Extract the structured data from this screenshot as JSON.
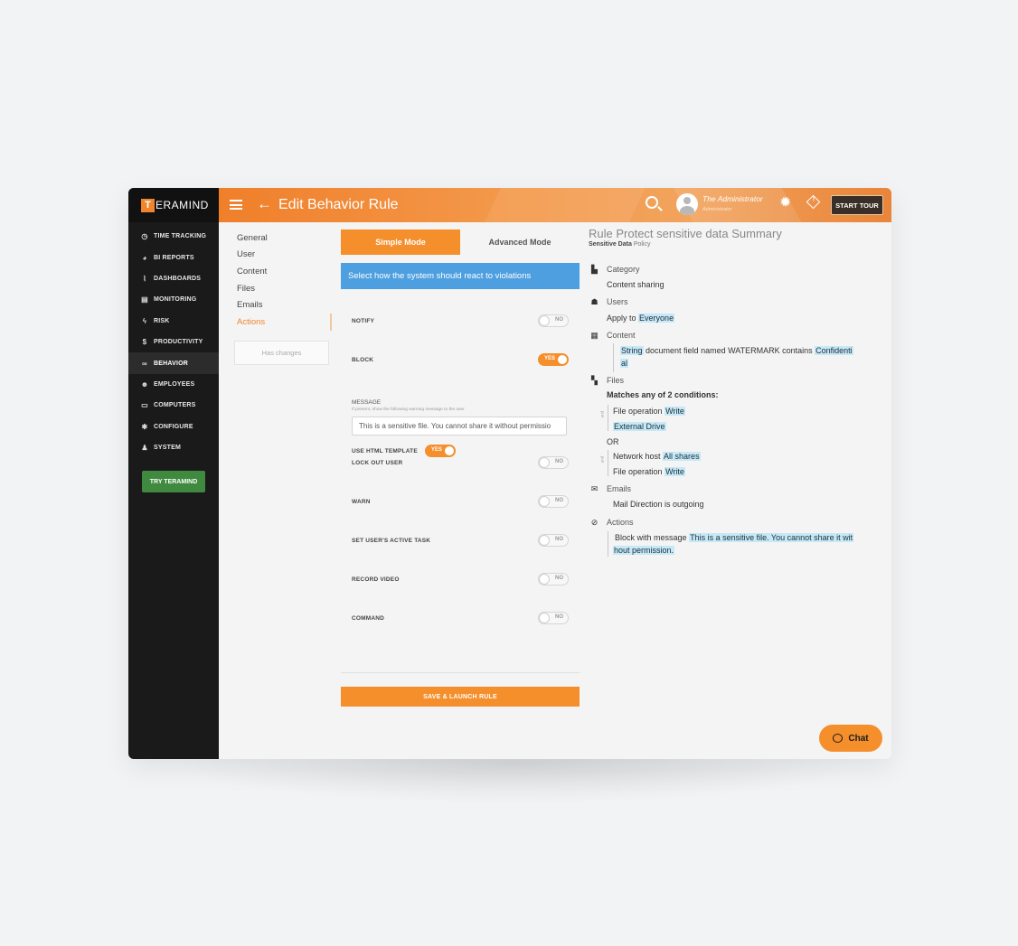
{
  "brand": {
    "logo_mark": "T",
    "logo_text": "ERAMIND"
  },
  "header": {
    "title": "Edit Behavior Rule",
    "user_name": "The Administrator",
    "user_role": "Administrator",
    "start_tour": "START TOUR"
  },
  "sidebar": {
    "items": [
      {
        "label": "TIME TRACKING",
        "icon": "clock-icon"
      },
      {
        "label": "BI REPORTS",
        "icon": "pie-chart-icon"
      },
      {
        "label": "DASHBOARDS",
        "icon": "dashboard-icon"
      },
      {
        "label": "MONITORING",
        "icon": "monitor-list-icon"
      },
      {
        "label": "RISK",
        "icon": "bolt-icon"
      },
      {
        "label": "PRODUCTIVITY",
        "icon": "dollar-icon"
      },
      {
        "label": "BEHAVIOR",
        "icon": "glasses-icon"
      },
      {
        "label": "EMPLOYEES",
        "icon": "user-icon"
      },
      {
        "label": "COMPUTERS",
        "icon": "desktop-icon"
      },
      {
        "label": "CONFIGURE",
        "icon": "gear-icon"
      },
      {
        "label": "SYSTEM",
        "icon": "admin-user-icon"
      }
    ],
    "active_index": 6,
    "try_button": "TRY TERAMIND"
  },
  "steps": {
    "items": [
      "General",
      "User",
      "Content",
      "Files",
      "Emails",
      "Actions"
    ],
    "active_index": 5,
    "has_changes": "Has changes"
  },
  "mode_tabs": {
    "simple": "Simple Mode",
    "advanced": "Advanced Mode",
    "active": "simple"
  },
  "info_bar": "Select how the system should react to violations",
  "actions": {
    "notify": {
      "label": "NOTIFY",
      "state": "NO"
    },
    "block": {
      "label": "BLOCK",
      "state": "YES"
    },
    "message_label": "MESSAGE",
    "message_hint": "If present, show the following warning message to the user",
    "message_value": "This is a sensitive file. You cannot share it without permissio",
    "use_html": {
      "label": "USE HTML TEMPLATE",
      "state": "YES"
    },
    "lock_out": {
      "label": "LOCK OUT USER",
      "state": "NO"
    },
    "warn": {
      "label": "WARN",
      "state": "NO"
    },
    "active_task": {
      "label": "SET USER'S ACTIVE TASK",
      "state": "NO"
    },
    "record_video": {
      "label": "RECORD VIDEO",
      "state": "NO"
    },
    "command": {
      "label": "COMMAND",
      "state": "NO"
    }
  },
  "save_button": "SAVE & LAUNCH RULE",
  "summary": {
    "title": "Rule Protect sensitive data Summary",
    "subtitle_bold": "Sensitive Data",
    "subtitle_rest": "Policy",
    "category": {
      "heading": "Category",
      "value": "Content sharing"
    },
    "users": {
      "heading": "Users",
      "prefix": "Apply to",
      "value": "Everyone"
    },
    "content": {
      "heading": "Content",
      "type": "String",
      "text": "document field named WATERMARK contains",
      "value_line1": "Confidenti",
      "value_line2": "al"
    },
    "files": {
      "heading": "Files",
      "matches": "Matches any of 2 conditions:",
      "and_label": "and",
      "g1_line1_prefix": "File operation",
      "g1_line1_value": "Write",
      "g1_line2_value": "External Drive",
      "or_label": "OR",
      "g2_line1_prefix": "Network host",
      "g2_line1_value": "All shares",
      "g2_line2_prefix": "File operation",
      "g2_line2_value": "Write"
    },
    "emails": {
      "heading": "Emails",
      "value": "Mail Direction is outgoing"
    },
    "actions": {
      "heading": "Actions",
      "prefix": "Block with message",
      "value_line1": "This is a sensitive file. You cannot share it wit",
      "value_line2": "hout permission."
    }
  },
  "chat_button": "Chat"
}
